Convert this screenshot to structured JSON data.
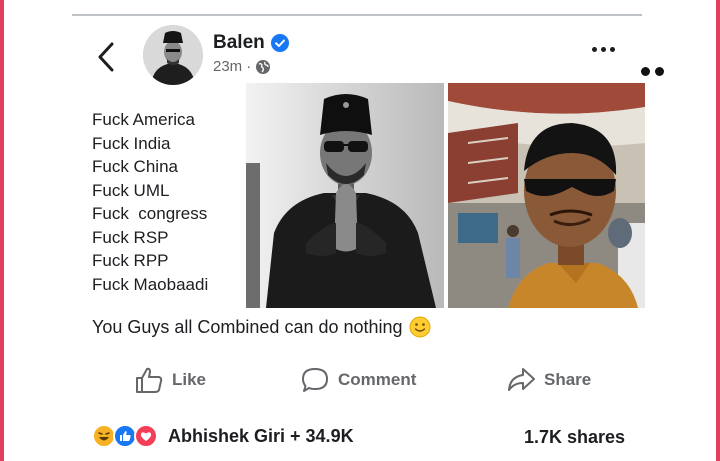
{
  "post": {
    "author": "Balen",
    "time": "23m",
    "separator": "·",
    "lines": [
      "Fuck America",
      "Fuck India",
      "Fuck China",
      "Fuck UML",
      "Fuck  congress",
      "Fuck RSP",
      "Fuck RPP",
      "Fuck Maobaadi"
    ],
    "caption": "You Guys all Combined can do nothing"
  },
  "actions": {
    "like": "Like",
    "comment": "Comment",
    "share": "Share"
  },
  "footer": {
    "reacted_by": "Abhishek Giri + 34.9K",
    "shares": "1.7K shares"
  },
  "icons": {
    "back": "chevron-left-icon",
    "verified": "verified-badge-icon",
    "audience": "globe-icon",
    "more": "more-options-icon",
    "like": "thumbs-up-icon",
    "comment": "comment-bubble-icon",
    "share": "share-arrow-icon",
    "reactions": [
      "haha-reaction-icon",
      "like-reaction-icon",
      "love-reaction-icon"
    ],
    "caption_emoji": "slightly-smiling-face-icon"
  },
  "colors": {
    "accent_blue": "#1877f2",
    "frame_pink": "#e0405e",
    "secondary_text": "#65676b",
    "love_red": "#f33e58",
    "haha_yellow": "#f7b125"
  }
}
